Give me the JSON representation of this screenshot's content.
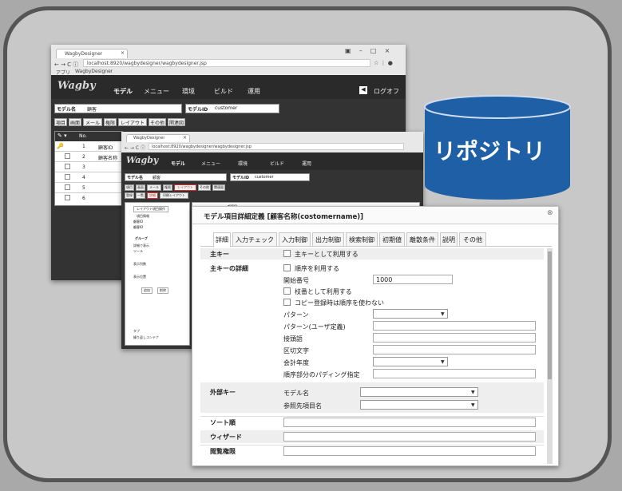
{
  "back_window": {
    "tab_title": "WagbyDesigner",
    "url": "localhost:8920/wagbydesigner/wagbydesigner.jsp",
    "bookmarks_apps": "アプリ",
    "bookmark": "WagbyDesigner",
    "logo": "Wagby",
    "nav": [
      "モデル",
      "メニュー",
      "環境",
      "ビルド",
      "運用"
    ],
    "logoff": "ログオフ",
    "model_name_label": "モデル名",
    "model_name_value": "顧客",
    "model_id_label": "モデルID",
    "model_id_value": "customer",
    "tabs": [
      "項目",
      "画面",
      "メール",
      "権限",
      "レイアウト",
      "その他",
      "関連図"
    ],
    "table_header": "No.",
    "rows": [
      {
        "no": "1",
        "name": "顧客ID"
      },
      {
        "no": "2",
        "name": "顧客名称"
      },
      {
        "no": "3",
        "name": ""
      },
      {
        "no": "4",
        "name": ""
      },
      {
        "no": "5",
        "name": ""
      },
      {
        "no": "6",
        "name": ""
      }
    ]
  },
  "mid_window": {
    "tab_title": "WagbyDesigner",
    "url": "localhost:8920/wagbydesigner/wagbydesigner.jsp",
    "logo": "Wagby",
    "nav": [
      "モデル",
      "メニュー",
      "環境",
      "ビルド",
      "運用"
    ],
    "model_name_label": "モデル名",
    "model_name_value": "顧客",
    "model_id_label": "モデルID",
    "model_id_value": "customer",
    "tabs_row1": [
      "項目",
      "画面",
      "メール",
      "権限",
      "レイアウト",
      "その他",
      "関連図"
    ],
    "tabs_row2": [
      "登録",
      "一覧",
      "詳細",
      "印刷レイアウト"
    ],
    "left_panel": [
      "レイアウト項目操作",
      "項目情報",
      "顧客ID",
      "顧客ID",
      "グループ",
      "詳細で表示",
      "ツール",
      "表示列数",
      "表示位置",
      "追加",
      "削除",
      "タブ",
      "繰り返しコンテナ"
    ],
    "right_header": "顧客ID"
  },
  "repository": {
    "label": "リポジトリ",
    "color": "#1f5fa6"
  },
  "dialog": {
    "title": "モデル項目詳細定義 [顧客名称(costomername)]",
    "close": "⊗",
    "tabs": [
      "詳細",
      "入力チェック",
      "入力制御",
      "出力制御",
      "検索制御",
      "初期値",
      "離散条件",
      "説明",
      "その他"
    ],
    "primary_key_label": "主キー",
    "primary_key_option": "主キーとして利用する",
    "pk_detail_label": "主キーの詳細",
    "sequence_label": "順序を利用する",
    "start_number_label": "開始番号",
    "start_number_value": "1000",
    "branch_label": "枝番として利用する",
    "copy_label": "コピー登録時は順序を使わない",
    "pattern_label": "パターン",
    "pattern_user_label": "パターン(ユーザ定義)",
    "prefix_label": "接頭語",
    "separator_label": "区切文字",
    "fiscal_label": "会計年度",
    "padding_label": "順序部分のパディング指定",
    "foreign_key_label": "外部キー",
    "fk_model_label": "モデル名",
    "fk_ref_label": "参照先項目名",
    "sort_label": "ソート順",
    "wizard_label": "ウィザード",
    "perm_label": "閲覧権限"
  }
}
